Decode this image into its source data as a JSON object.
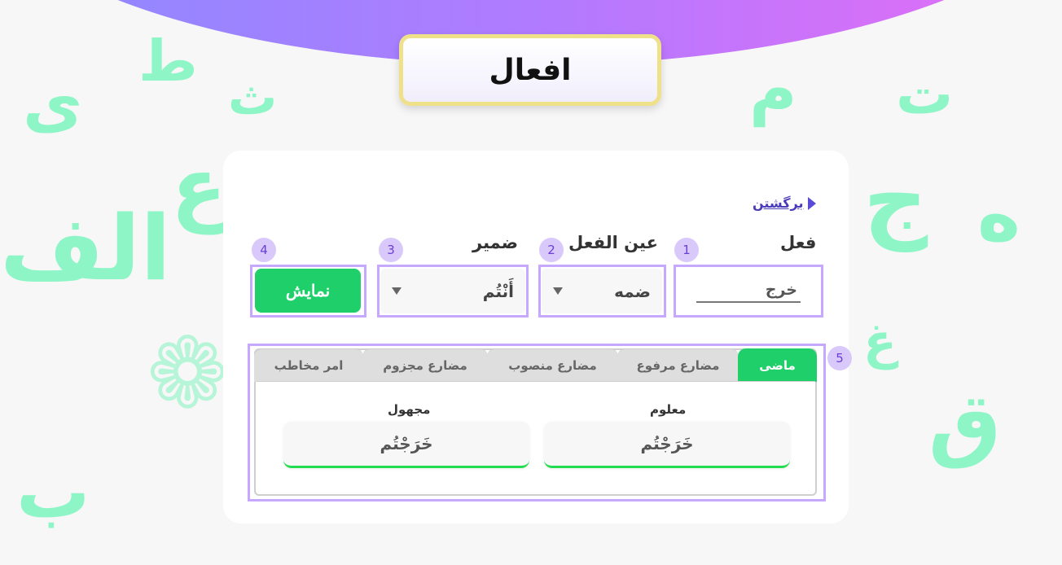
{
  "page": {
    "title": "افعال"
  },
  "nav": {
    "back_label": "برگشتن"
  },
  "fields": {
    "verb": {
      "label": "فعل",
      "value": "خرج",
      "badge": "1"
    },
    "ain": {
      "label": "عین الفعل",
      "value": "ضمه",
      "badge": "2"
    },
    "pronoun": {
      "label": "ضمیر",
      "value": "أَنْتُم",
      "badge": "3"
    },
    "show": {
      "label": "نمایش",
      "badge": "4"
    }
  },
  "tabs": {
    "badge": "5",
    "items": [
      {
        "label": "ماضی",
        "active": true
      },
      {
        "label": "مضارع مرفوع",
        "active": false
      },
      {
        "label": "مضارع منصوب",
        "active": false
      },
      {
        "label": "مضارع مجزوم",
        "active": false
      },
      {
        "label": "امر مخاطب",
        "active": false
      }
    ]
  },
  "results": {
    "active": {
      "label": "معلوم",
      "value": "خَرَجْتُم"
    },
    "passive": {
      "label": "مجهول",
      "value": "خَرَجْتُم"
    }
  },
  "colors": {
    "accent": "#1fd06a",
    "highlight": "#c6a8ff",
    "badge_bg": "#d9c9fb",
    "link": "#4a3bb8"
  },
  "icons": {
    "back": "triangle-left-icon",
    "dropdown": "caret-down-icon"
  }
}
